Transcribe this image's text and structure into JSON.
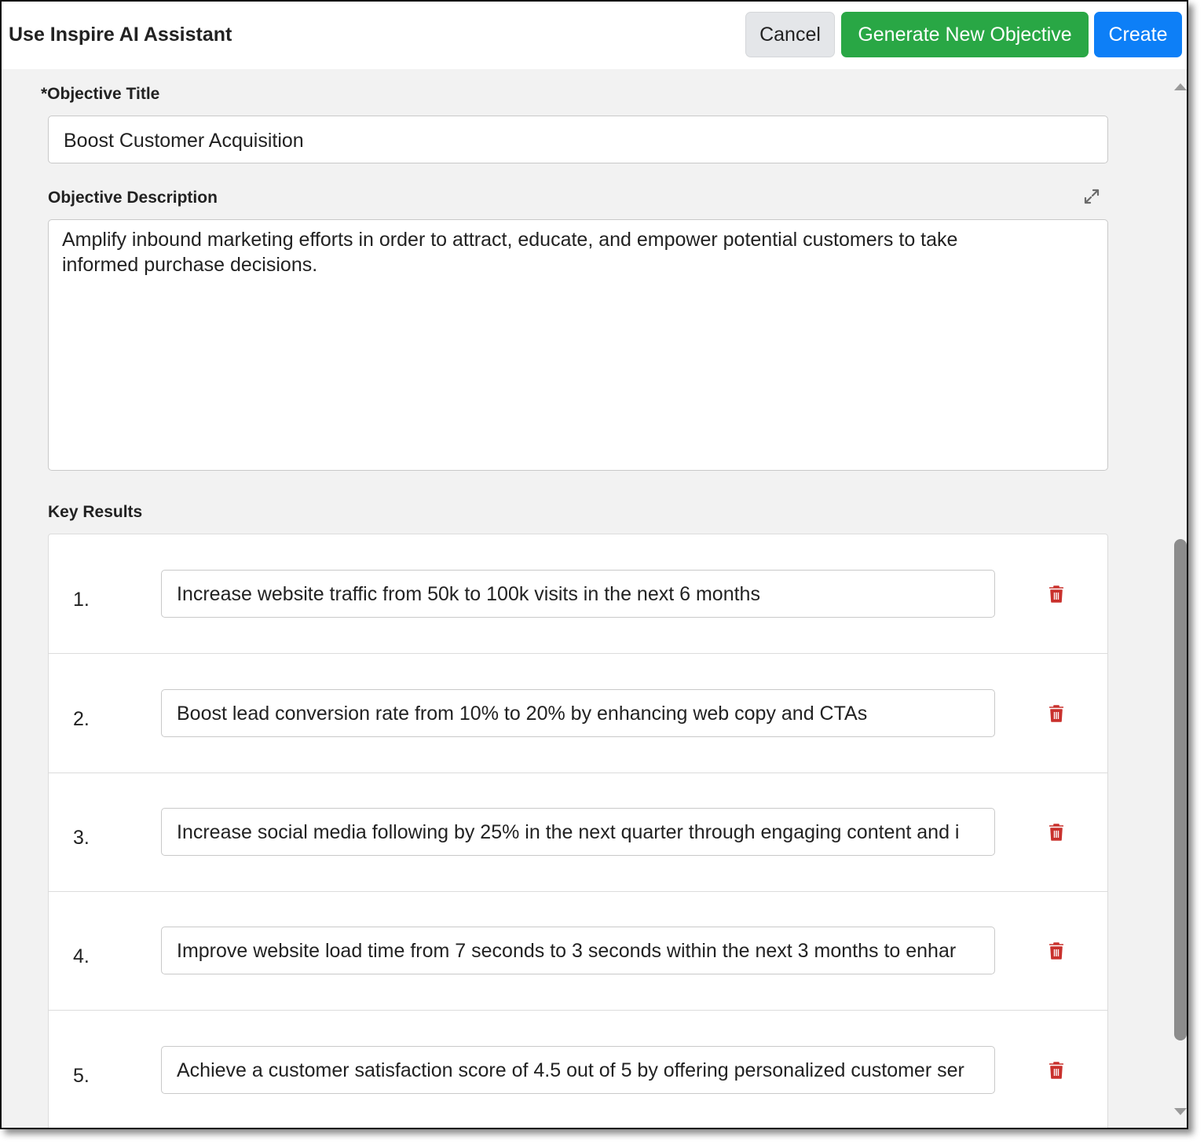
{
  "header": {
    "title": "Use Inspire AI Assistant",
    "cancel_label": "Cancel",
    "generate_label": "Generate New Objective",
    "create_label": "Create"
  },
  "form": {
    "title_label": "*Objective Title",
    "title_value": "Boost Customer Acquisition",
    "description_label": "Objective Description",
    "description_value": "Amplify inbound marketing efforts in order to attract, educate, and empower potential customers to take informed purchase decisions.",
    "key_results_label": "Key Results"
  },
  "key_results": [
    {
      "number": "1.",
      "text": "Increase website traffic from 50k to 100k visits in the next 6 months"
    },
    {
      "number": "2.",
      "text": "Boost lead conversion rate from 10% to 20% by enhancing web copy and CTAs"
    },
    {
      "number": "3.",
      "text": "Increase social media following by 25% in the next quarter through engaging content and i"
    },
    {
      "number": "4.",
      "text": "Improve website load time from 7 seconds to 3 seconds within the next 3 months to enhar"
    },
    {
      "number": "5.",
      "text": "Achieve a customer satisfaction score of 4.5 out of 5 by offering personalized customer ser"
    }
  ],
  "colors": {
    "generate_button": "#29a745",
    "create_button": "#0d7ff7",
    "cancel_button": "#e4e6e9",
    "trash_icon": "#c9302c"
  },
  "icons": {
    "expand": "expand-icon",
    "delete": "trash-icon"
  }
}
